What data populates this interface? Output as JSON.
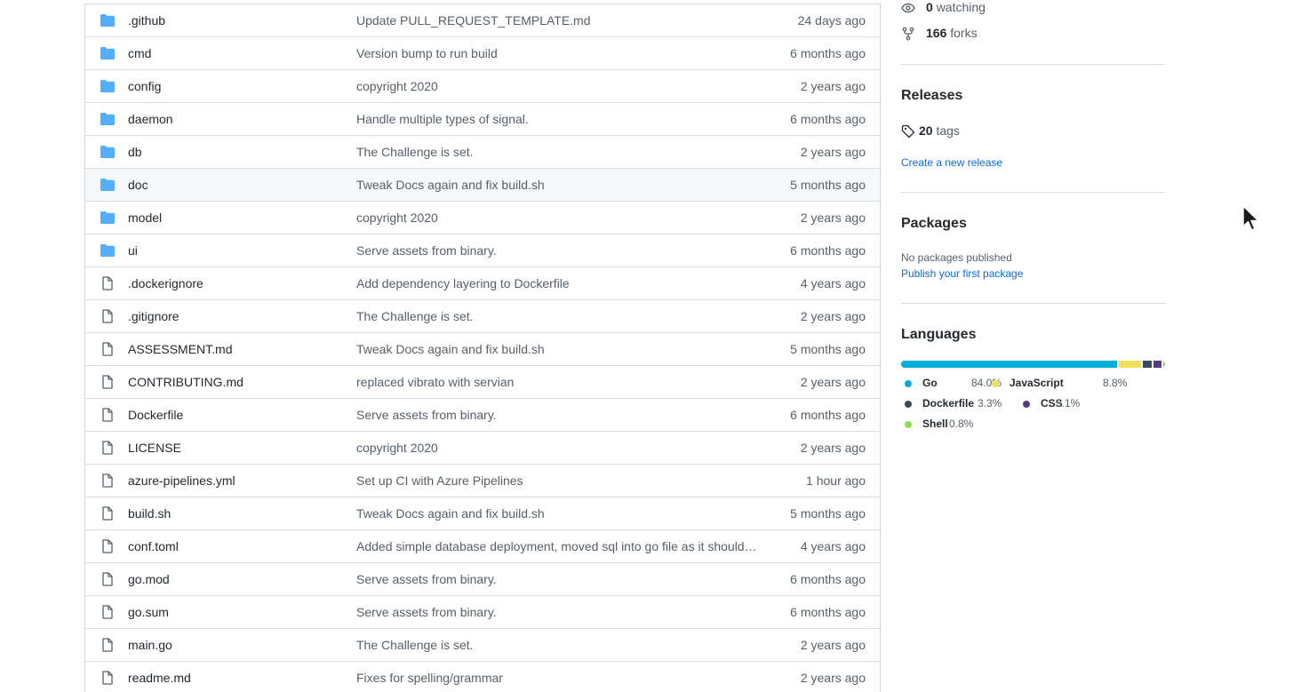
{
  "files": [
    {
      "type": "folder",
      "name": ".github",
      "message": "Update PULL_REQUEST_TEMPLATE.md",
      "age": "24 days ago"
    },
    {
      "type": "folder",
      "name": "cmd",
      "message": "Version bump to run build",
      "age": "6 months ago"
    },
    {
      "type": "folder",
      "name": "config",
      "message": "copyright 2020",
      "age": "2 years ago"
    },
    {
      "type": "folder",
      "name": "daemon",
      "message": "Handle multiple types of signal.",
      "age": "6 months ago"
    },
    {
      "type": "folder",
      "name": "db",
      "message": "The Challenge is set.",
      "age": "2 years ago"
    },
    {
      "type": "folder",
      "name": "doc",
      "message": "Tweak Docs again and fix build.sh",
      "age": "5 months ago"
    },
    {
      "type": "folder",
      "name": "model",
      "message": "copyright 2020",
      "age": "2 years ago"
    },
    {
      "type": "folder",
      "name": "ui",
      "message": "Serve assets from binary.",
      "age": "6 months ago"
    },
    {
      "type": "file",
      "name": ".dockerignore",
      "message": "Add dependency layering to Dockerfile",
      "age": "4 years ago"
    },
    {
      "type": "file",
      "name": ".gitignore",
      "message": "The Challenge is set.",
      "age": "2 years ago"
    },
    {
      "type": "file",
      "name": "ASSESSMENT.md",
      "message": "Tweak Docs again and fix build.sh",
      "age": "5 months ago"
    },
    {
      "type": "file",
      "name": "CONTRIBUTING.md",
      "message": "replaced vibrato with servian",
      "age": "2 years ago"
    },
    {
      "type": "file",
      "name": "Dockerfile",
      "message": "Serve assets from binary.",
      "age": "6 months ago"
    },
    {
      "type": "file",
      "name": "LICENSE",
      "message": "copyright 2020",
      "age": "2 years ago"
    },
    {
      "type": "file",
      "name": "azure-pipelines.yml",
      "message": "Set up CI with Azure Pipelines",
      "age": "1 hour ago"
    },
    {
      "type": "file",
      "name": "build.sh",
      "message": "Tweak Docs again and fix build.sh",
      "age": "5 months ago"
    },
    {
      "type": "file",
      "name": "conf.toml",
      "message": "Added simple database deployment, moved sql into go file as it should…",
      "age": "4 years ago"
    },
    {
      "type": "file",
      "name": "go.mod",
      "message": "Serve assets from binary.",
      "age": "6 months ago"
    },
    {
      "type": "file",
      "name": "go.sum",
      "message": "Serve assets from binary.",
      "age": "6 months ago"
    },
    {
      "type": "file",
      "name": "main.go",
      "message": "The Challenge is set.",
      "age": "2 years ago"
    },
    {
      "type": "file",
      "name": "readme.md",
      "message": "Fixes for spelling/grammar",
      "age": "2 years ago"
    }
  ],
  "sidebar": {
    "watching_count": "0",
    "watching_label": "watching",
    "forks_count": "166",
    "forks_label": "forks",
    "releases_heading": "Releases",
    "tags_count": "20",
    "tags_label": "tags",
    "create_release_link": "Create a new release",
    "packages_heading": "Packages",
    "no_packages_text": "No packages published",
    "publish_package_link": "Publish your first package",
    "languages_heading": "Languages",
    "languages": [
      {
        "name": "Go",
        "percent": "84.0%",
        "value": 84.0,
        "color": "#00ADD8"
      },
      {
        "name": "JavaScript",
        "percent": "8.8%",
        "value": 8.8,
        "color": "#f1e05a"
      },
      {
        "name": "Dockerfile",
        "percent": "3.3%",
        "value": 3.3,
        "color": "#384d54"
      },
      {
        "name": "CSS",
        "percent": "3.1%",
        "value": 3.1,
        "color": "#563d7c"
      },
      {
        "name": "Shell",
        "percent": "0.8%",
        "value": 0.8,
        "color": "#89e051"
      }
    ]
  },
  "colors": {
    "folder_icon": "#54aeff",
    "file_icon": "#57606a",
    "link": "#0969da"
  }
}
